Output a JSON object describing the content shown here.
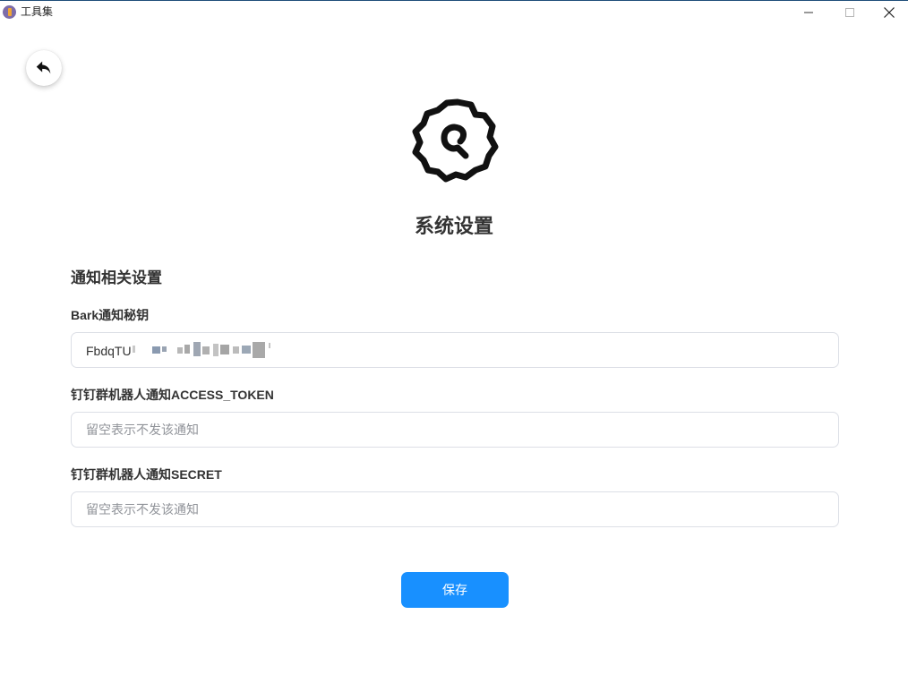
{
  "window": {
    "title": "工具集",
    "icon": "app-icon",
    "controls": [
      "minimize-icon",
      "maximize-icon",
      "close-icon"
    ]
  },
  "back_button": {
    "icon": "undo-arrow-icon"
  },
  "header": {
    "icon": "gear-icon",
    "title": "系统设置"
  },
  "section": {
    "title": "通知相关设置"
  },
  "fields": [
    {
      "label": "Bark通知秘钥",
      "value": "FbdqTU",
      "redacted": true,
      "placeholder": ""
    },
    {
      "label": "钉钉群机器人通知ACCESS_TOKEN",
      "value": "",
      "placeholder": "留空表示不发该通知"
    },
    {
      "label": "钉钉群机器人通知SECRET",
      "value": "",
      "placeholder": "留空表示不发该通知"
    }
  ],
  "save_button": {
    "label": "保存"
  },
  "colors": {
    "primary": "#1890ff",
    "text": "#333333",
    "border": "#dcdfe6",
    "placeholder": "#909399"
  }
}
